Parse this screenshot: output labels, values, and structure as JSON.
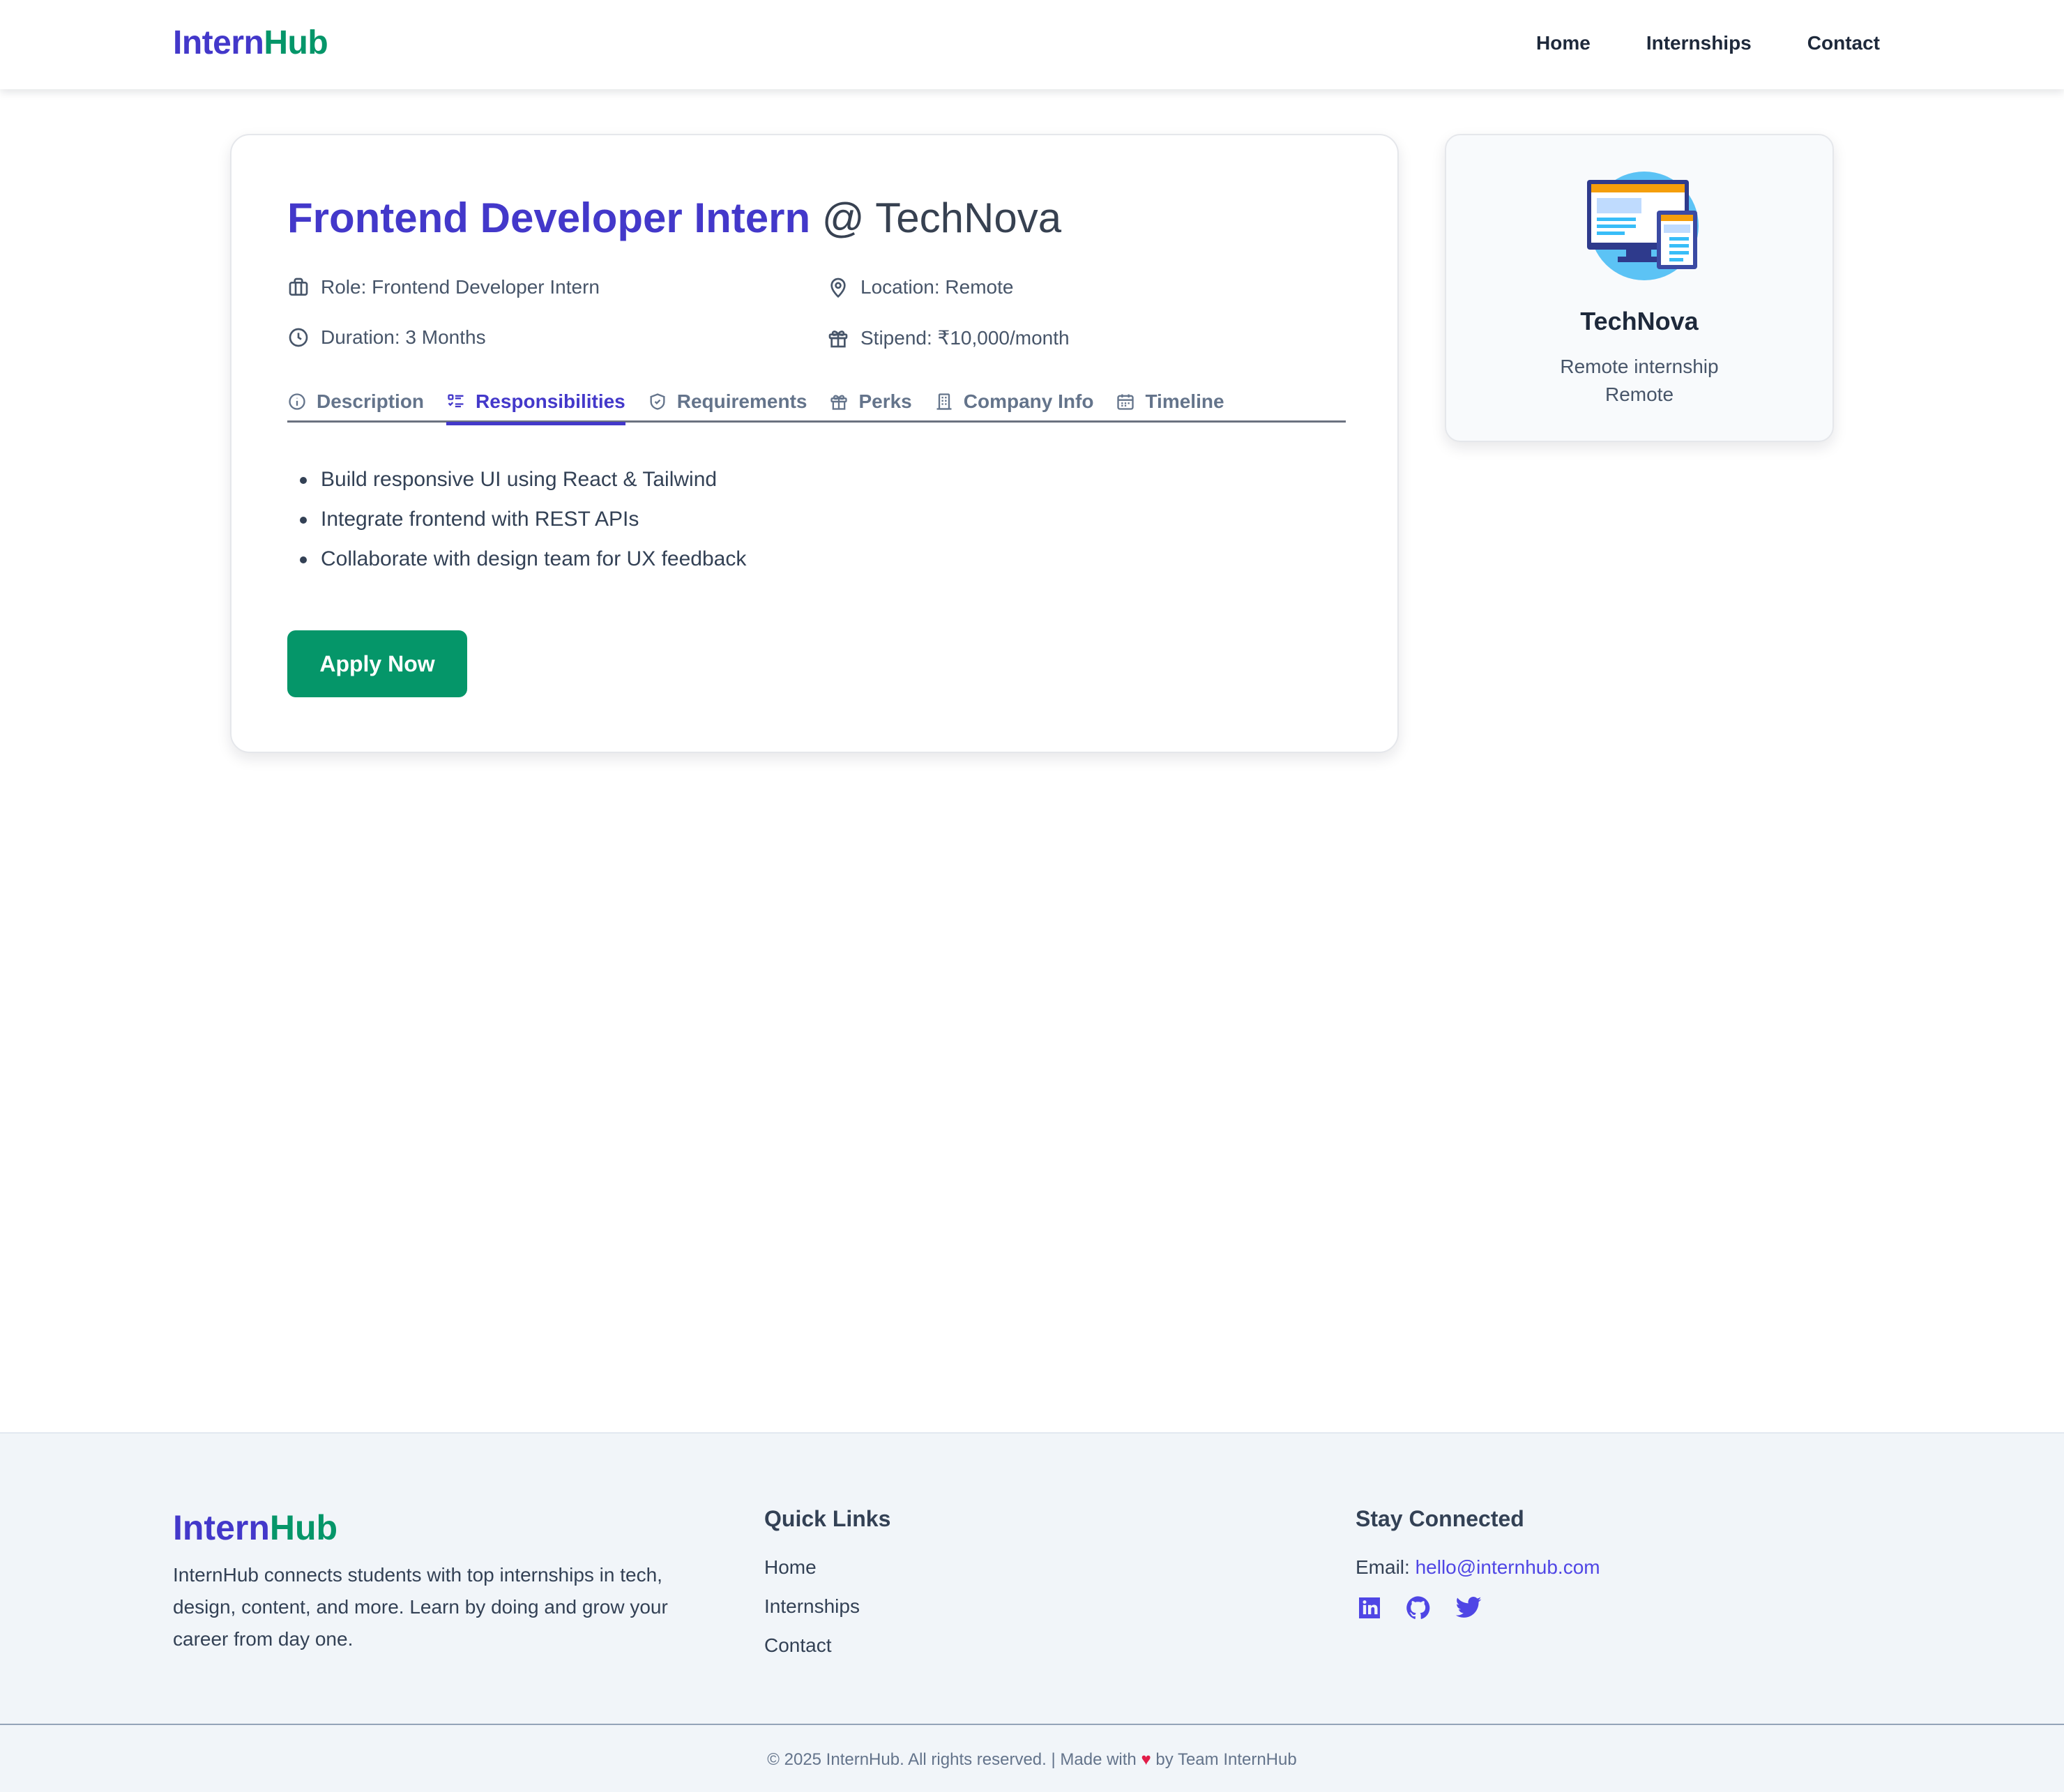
{
  "header": {
    "brand_part1": "Intern",
    "brand_part2": "Hub",
    "nav": [
      "Home",
      "Internships",
      "Contact"
    ]
  },
  "job": {
    "role": "Frontend Developer Intern",
    "company_suffix": "@ TechNova",
    "meta": {
      "role": "Role: Frontend Developer Intern",
      "location": "Location: Remote",
      "duration": "Duration: 3 Months",
      "stipend": "Stipend: ₹10,000/month"
    },
    "tabs": [
      {
        "label": "Description",
        "icon": "info-icon",
        "active": false
      },
      {
        "label": "Responsibilities",
        "icon": "list-icon",
        "active": true
      },
      {
        "label": "Requirements",
        "icon": "shield-icon",
        "active": false
      },
      {
        "label": "Perks",
        "icon": "gift-icon",
        "active": false
      },
      {
        "label": "Company Info",
        "icon": "building-icon",
        "active": false
      },
      {
        "label": "Timeline",
        "icon": "calendar-icon",
        "active": false
      }
    ],
    "responsibilities": [
      "Build responsive UI using React & Tailwind",
      "Integrate frontend with REST APIs",
      "Collaborate with design team for UX feedback"
    ],
    "apply_label": "Apply Now"
  },
  "company_card": {
    "logo_icon": "computer-screens-icon",
    "name": "TechNova",
    "type": "Remote internship",
    "location": "Remote"
  },
  "footer": {
    "brand_part1": "Intern",
    "brand_part2": "Hub",
    "about": "InternHub connects students with top internships in tech, design, content, and more. Learn by doing and grow your career from day one.",
    "quick_links_title": "Quick Links",
    "quick_links": [
      "Home",
      "Internships",
      "Contact"
    ],
    "connect_title": "Stay Connected",
    "email_label": "Email:",
    "email": "hello@internhub.com",
    "social": [
      "linkedin-icon",
      "github-icon",
      "twitter-icon"
    ],
    "copyright_left": "© 2025 InternHub. All rights reserved. | Made with",
    "heart": "♥",
    "copyright_right": "by Team InternHub"
  },
  "colors": {
    "primary": "#4338ca",
    "accent": "#059669",
    "link": "#4f46e5",
    "footer_bg": "#f1f5f9"
  }
}
